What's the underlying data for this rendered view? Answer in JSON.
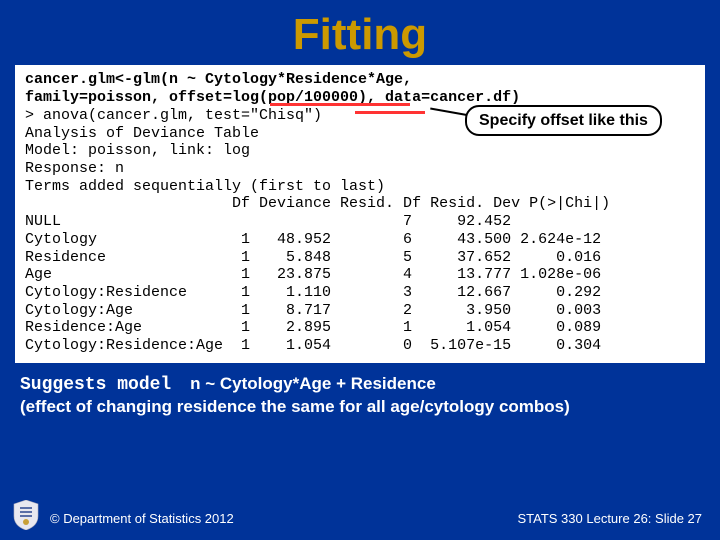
{
  "title": "Fitting",
  "code_line1": "cancer.glm<-glm(n ~ Cytology*Residence*Age,",
  "code_line2": "family=poisson, offset=log(pop/100000), data=cancer.df)",
  "callout": "Specify offset like this",
  "anova_header": "> anova(cancer.glm, test=\"Chisq\")",
  "anova_lines": [
    "Analysis of Deviance Table",
    "Model: poisson, link: log",
    "Response: n",
    "Terms added sequentially (first to last)",
    "                       Df Deviance Resid. Df Resid. Dev P(>|Chi|)",
    "NULL                                      7     92.452          ",
    "Cytology                1   48.952        6     43.500 2.624e-12",
    "Residence               1    5.848        5     37.652     0.016",
    "Age                     1   23.875        4     13.777 1.028e-06",
    "Cytology:Residence      1    1.110        3     12.667     0.292",
    "Cytology:Age            1    8.717        2      3.950     0.003",
    "Residence:Age           1    2.895        1      1.054     0.089",
    "Cytology:Residence:Age  1    1.054        0  5.107e-15     0.304"
  ],
  "conclusion_lead": "Suggests model",
  "conclusion_model": "n ~ Cytology*Age + Residence",
  "conclusion_sub": "(effect of changing residence the same for all age/cytology combos)",
  "footer_left": "© Department of Statistics 2012",
  "footer_right": "STATS 330 Lecture 26: Slide 27"
}
